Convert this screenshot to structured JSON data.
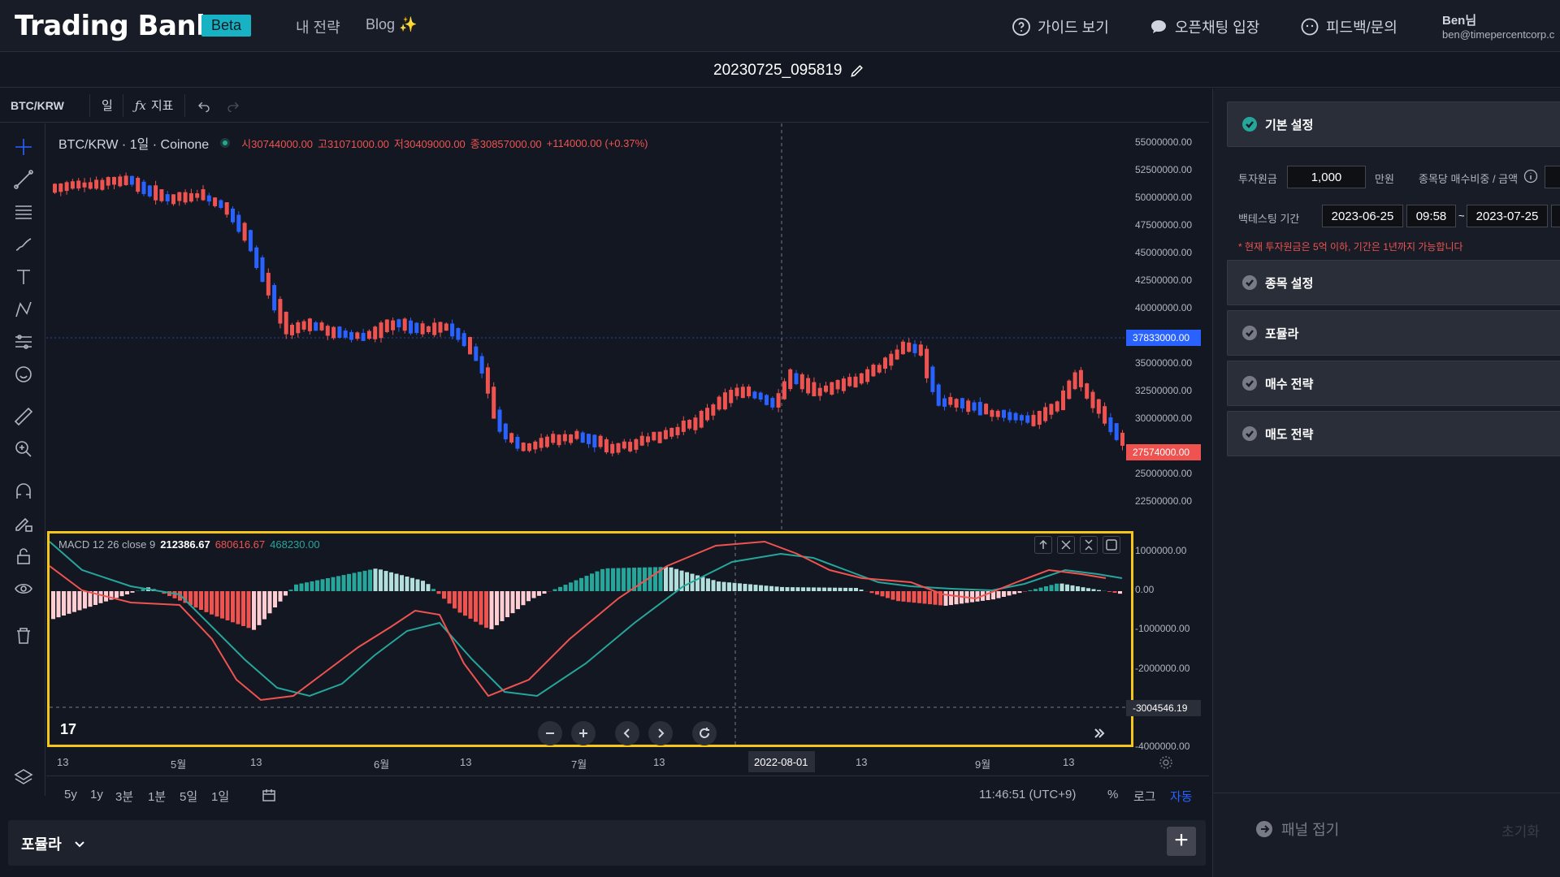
{
  "app": {
    "logo": "Trading Bank",
    "badge": "Beta"
  },
  "nav": {
    "strategy": "내 전략",
    "blog": "Blog ✨"
  },
  "actions": {
    "guide": "가이드 보기",
    "openchat": "오픈채팅 입장",
    "feedback": "피드백/문의"
  },
  "user": {
    "name": "Ben님",
    "email": "ben@timepercentcorp.c"
  },
  "strategy_title": "20230725_095819",
  "toolbar": {
    "symbol": "BTC/KRW",
    "interval": "일",
    "indicator": "지표"
  },
  "legend": {
    "symbol": "BTC/KRW · 1일 · Coinone",
    "open": "시30744000.00",
    "high": "고31071000.00",
    "low": "저30409000.00",
    "close": "종30857000.00",
    "change": "+114000.00 (+0.37%)"
  },
  "macd_legend": {
    "name": "MACD 12 26 close 9",
    "v1": "212386.67",
    "v2": "680616.67",
    "v3": "468230.00"
  },
  "price_scale": [
    "55000000.00",
    "52500000.00",
    "50000000.00",
    "47500000.00",
    "45000000.00",
    "42500000.00",
    "40000000.00",
    "35000000.00",
    "32500000.00",
    "30000000.00",
    "25000000.00",
    "22500000.00"
  ],
  "price_tags": {
    "crosshair": "37833000.00",
    "last": "27574000.00"
  },
  "macd_scale": [
    "1000000.00",
    "0.00",
    "-1000000.00",
    "-2000000.00",
    "-3000000.00",
    "-4000000.00"
  ],
  "macd_tag": "-3004546.19",
  "time_axis": [
    "13",
    "5월",
    "13",
    "6월",
    "13",
    "7월",
    "13",
    "13",
    "9월",
    "13"
  ],
  "time_highlight": "2022-08-01",
  "ranges": [
    "5y",
    "1y",
    "3분",
    "1분",
    "5일",
    "1일"
  ],
  "clock": "11:46:51 (UTC+9)",
  "scale_opts": {
    "pct": "%",
    "log": "로그",
    "auto": "자동"
  },
  "formula_bar": {
    "label": "포뮬라"
  },
  "panel": {
    "basic": "기본 설정",
    "invest_label": "투자원금",
    "invest_value": "1,000",
    "invest_unit": "만원",
    "ratio_label": "종목당 매수비중 / 금액",
    "period_label": "백테스팅 기간",
    "start_date": "2023-06-25",
    "start_time": "09:58",
    "tilde": "~",
    "end_date": "2023-07-25",
    "warning": "* 현재 투자원금은 5억 이하, 기간은 1년까지 가능합니다",
    "stock": "종목 설정",
    "formula": "포뮬라",
    "buy": "매수 전략",
    "sell": "매도 전략",
    "collapse": "패널 접기",
    "reset": "초기화"
  },
  "colors": {
    "up": "#ef5350",
    "down": "#2962ff",
    "accent": "#26a69a",
    "highlight": "#f5c518"
  }
}
